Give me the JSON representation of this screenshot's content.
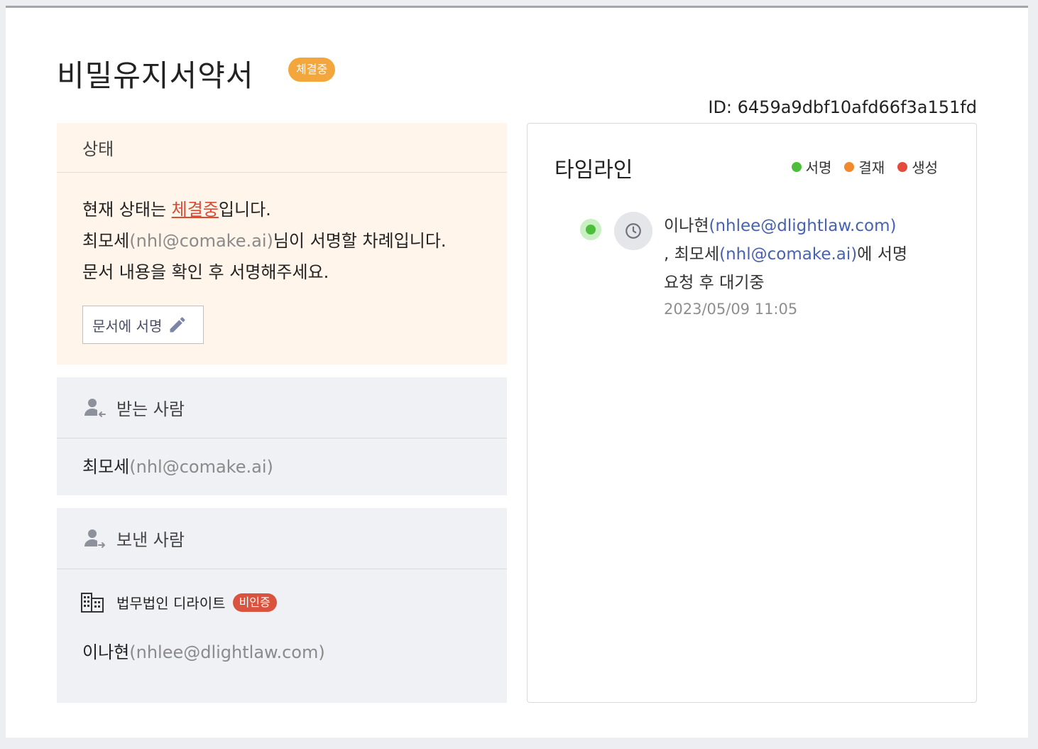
{
  "document": {
    "title": "비밀유지서약서",
    "status_badge": "체결중",
    "id_text": "ID: 6459a9dbf10afd66f3a151fd"
  },
  "status_card": {
    "header": "상태",
    "line1_prefix": "현재 상태는 ",
    "line1_status": "체결중",
    "line1_suffix": "입니다.",
    "line2_name": "최모세",
    "line2_email": "(nhl@comake.ai)",
    "line2_suffix": "님이 서명할 차례입니다.",
    "line3": "문서 내용을 확인 후 서명해주세요.",
    "sign_button": "문서에 서명"
  },
  "recipient_card": {
    "header": "받는 사람",
    "name": "최모세",
    "email": "(nhl@comake.ai)"
  },
  "sender_card": {
    "header": "보낸 사람",
    "org_name": "법무법인 디라이트",
    "org_badge": "비인증",
    "name": "이나현",
    "email": "(nhlee@dlightlaw.com)"
  },
  "timeline": {
    "title": "타임라인",
    "legend": [
      {
        "label": "서명",
        "color": "#4cbe3c"
      },
      {
        "label": "결재",
        "color": "#f08a2c"
      },
      {
        "label": "생성",
        "color": "#e54b3c"
      }
    ],
    "entries": [
      {
        "actor_name": "이나현",
        "actor_email": "(nhlee@dlightlaw.com)",
        "separator": ", ",
        "target_name": "최모세",
        "target_email": "(nhl@comake.ai)",
        "action_suffix": "에 서명",
        "action_line2": "요청 후 대기중",
        "timestamp": "2023/05/09 11:05",
        "status_color": "#4cbe3c",
        "icon": "clock-icon"
      }
    ]
  },
  "colors": {
    "status_badge": "#f2a63b",
    "highlight_red": "#d94c34",
    "unverified_badge": "#d9533e",
    "email_blue": "#4762b0"
  }
}
